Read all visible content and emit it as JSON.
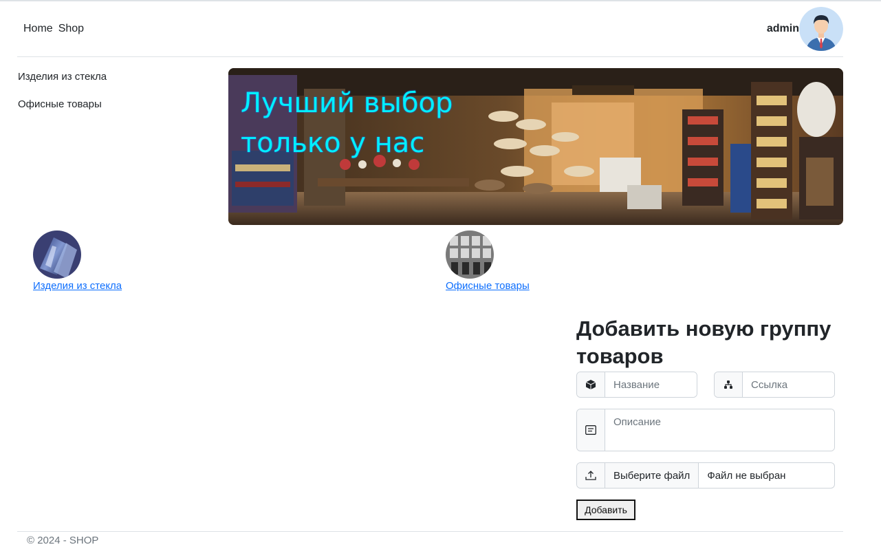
{
  "nav": {
    "home": "Home",
    "shop": "Shop"
  },
  "user": {
    "name": "admin"
  },
  "sidebar": {
    "items": [
      {
        "label": "Изделия из стекла"
      },
      {
        "label": "Офисные товары"
      }
    ]
  },
  "banner": {
    "line1": "Лучший выбор",
    "line2": "только у нас"
  },
  "categories": [
    {
      "label": "Изделия из стекла"
    },
    {
      "label": "Офисные товары"
    }
  ],
  "form": {
    "title": "Добавить новую группу товаров",
    "name_placeholder": "Название",
    "link_placeholder": "Ссылка",
    "description_placeholder": "Описание",
    "file_button": "Выберите файл",
    "file_status": "Файл не выбран",
    "submit": "Добавить"
  },
  "footer": {
    "text": "© 2024 - SHOP"
  },
  "colors": {
    "link": "#0d6efd",
    "banner_text": "#00f0ff"
  }
}
